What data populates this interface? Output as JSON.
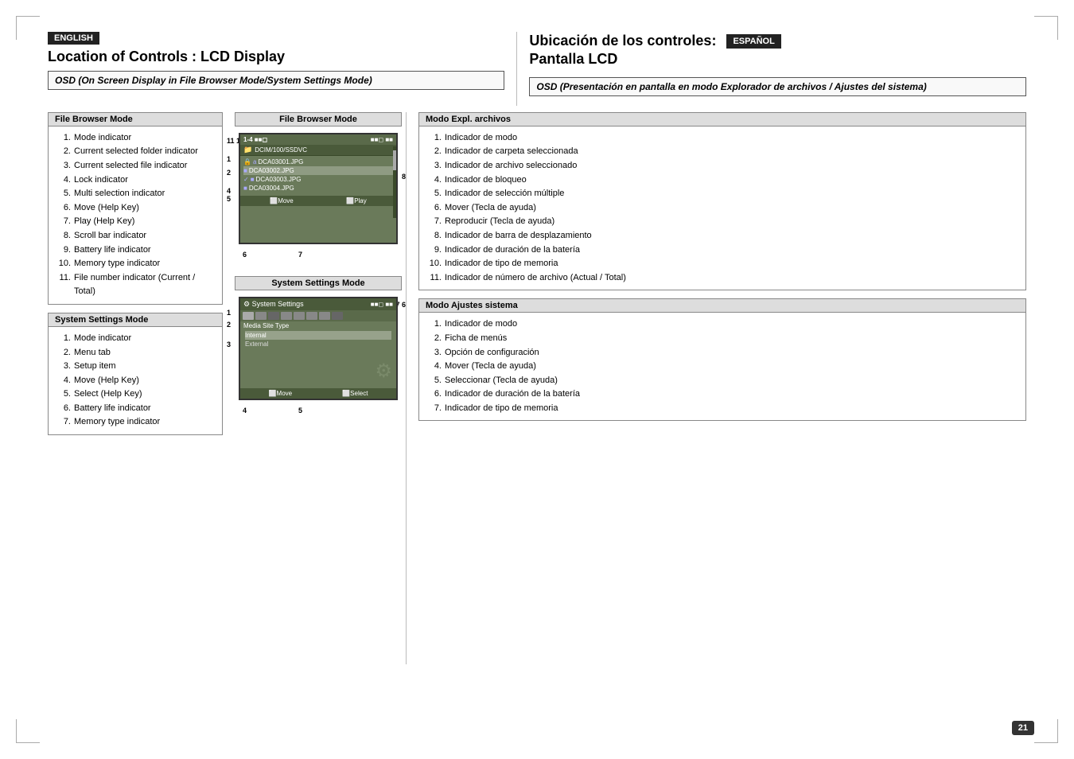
{
  "page": {
    "number": "21",
    "left_lang_badge": "ENGLISH",
    "right_lang_badge": "ESPAÑOL",
    "left_title": "Location of Controls : LCD Display",
    "right_title_line1": "Ubicación de los controles:",
    "right_title_line2": "Pantalla LCD",
    "left_subtitle": "OSD (On Screen Display in File Browser Mode/System Settings Mode)",
    "right_subtitle": "OSD (Presentación en pantalla en modo Explorador de archivos / Ajustes del sistema)",
    "file_browser_mode_label": "File Browser Mode",
    "system_settings_mode_label": "System Settings Mode",
    "file_browser_mode_es_label": "Modo Expl. archivos",
    "system_settings_mode_es_label": "Modo Ajustes sistema",
    "left_file_browser_items": [
      {
        "num": "1.",
        "text": "Mode indicator"
      },
      {
        "num": "2.",
        "text": "Current selected folder indicator"
      },
      {
        "num": "3.",
        "text": "Current selected file indicator"
      },
      {
        "num": "4.",
        "text": "Lock indicator"
      },
      {
        "num": "5.",
        "text": "Multi selection indicator"
      },
      {
        "num": "6.",
        "text": "Move (Help Key)"
      },
      {
        "num": "7.",
        "text": "Play (Help Key)"
      },
      {
        "num": "8.",
        "text": "Scroll bar indicator"
      },
      {
        "num": "9.",
        "text": "Battery life indicator"
      },
      {
        "num": "10.",
        "text": "Memory type indicator"
      },
      {
        "num": "11.",
        "text": "File number indicator (Current / Total)"
      }
    ],
    "left_system_settings_items": [
      {
        "num": "1.",
        "text": "Mode indicator"
      },
      {
        "num": "2.",
        "text": "Menu tab"
      },
      {
        "num": "3.",
        "text": "Setup item"
      },
      {
        "num": "4.",
        "text": "Move (Help Key)"
      },
      {
        "num": "5.",
        "text": "Select (Help Key)"
      },
      {
        "num": "6.",
        "text": "Battery life indicator"
      },
      {
        "num": "7.",
        "text": "Memory type indicator"
      }
    ],
    "right_file_browser_items": [
      {
        "num": "1.",
        "text": "Indicador de modo"
      },
      {
        "num": "2.",
        "text": "Indicador de carpeta seleccionada"
      },
      {
        "num": "3.",
        "text": "Indicador de archivo seleccionado"
      },
      {
        "num": "4.",
        "text": "Indicador de bloqueo"
      },
      {
        "num": "5.",
        "text": "Indicador de selección múltiple"
      },
      {
        "num": "6.",
        "text": "Mover (Tecla de ayuda)"
      },
      {
        "num": "7.",
        "text": "Reproducir (Tecla de ayuda)"
      },
      {
        "num": "8.",
        "text": "Indicador de barra de desplazamiento"
      },
      {
        "num": "9.",
        "text": "Indicador de duración de la batería"
      },
      {
        "num": "10.",
        "text": "Indicador de tipo de memoria"
      },
      {
        "num": "11.",
        "text": "Indicador de número de archivo (Actual / Total)"
      }
    ],
    "right_system_settings_items": [
      {
        "num": "1.",
        "text": "Indicador de modo"
      },
      {
        "num": "2.",
        "text": "Ficha de menús"
      },
      {
        "num": "3.",
        "text": "Opción de configuración"
      },
      {
        "num": "4.",
        "text": "Mover (Tecla de ayuda)"
      },
      {
        "num": "5.",
        "text": "Seleccionar (Tecla de ayuda)"
      },
      {
        "num": "6.",
        "text": "Indicador de duración de la batería"
      },
      {
        "num": "7.",
        "text": "Indicador de tipo de memoria"
      }
    ],
    "fb_screen": {
      "path": "DCIM/100/SSDVC",
      "files": [
        "DCA03001.JPG",
        "DCA03002.JPG",
        "DCA03003.JPG",
        "DCA03004.JPG"
      ],
      "footer_left": "Move",
      "footer_right": "Play",
      "num_indicator": "1-4",
      "battery_indicator": "Battery",
      "scroll_label": "8"
    },
    "ss_screen": {
      "title": "System Settings",
      "label": "Media Site Type",
      "items": [
        "Internal",
        "External"
      ],
      "footer_left": "Move",
      "footer_right": "Select"
    }
  }
}
